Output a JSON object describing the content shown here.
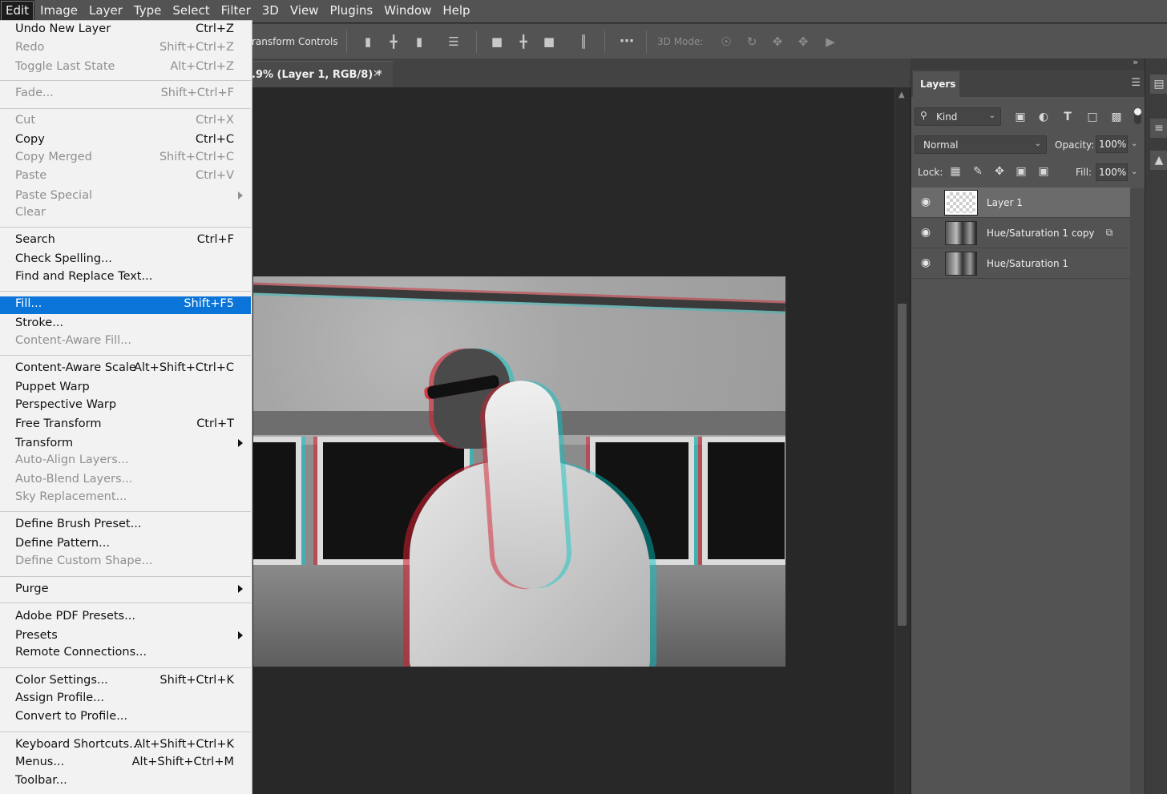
{
  "menubar": {
    "items": [
      "Edit",
      "Image",
      "Layer",
      "Type",
      "Select",
      "Filter",
      "3D",
      "View",
      "Plugins",
      "Window",
      "Help"
    ],
    "active_index": 0
  },
  "options_bar": {
    "transform_controls_text": "ransform Controls",
    "more_icon": "ellipsis-icon",
    "three_d_mode_label": "3D Mode:"
  },
  "document_tab": {
    "title": ".9% (Layer 1, RGB/8) *",
    "close_icon": "close-icon"
  },
  "edit_menu": {
    "items": [
      {
        "label": "Undo New Layer",
        "shortcut": "Ctrl+Z",
        "disabled": false
      },
      {
        "label": "Redo",
        "shortcut": "Shift+Ctrl+Z",
        "disabled": true
      },
      {
        "label": "Toggle Last State",
        "shortcut": "Alt+Ctrl+Z",
        "disabled": true
      },
      {
        "sep": true
      },
      {
        "label": "Fade...",
        "shortcut": "Shift+Ctrl+F",
        "disabled": true
      },
      {
        "sep": true
      },
      {
        "label": "Cut",
        "shortcut": "Ctrl+X",
        "disabled": true
      },
      {
        "label": "Copy",
        "shortcut": "Ctrl+C",
        "disabled": false
      },
      {
        "label": "Copy Merged",
        "shortcut": "Shift+Ctrl+C",
        "disabled": true
      },
      {
        "label": "Paste",
        "shortcut": "Ctrl+V",
        "disabled": true
      },
      {
        "label": "Paste Special",
        "shortcut": "",
        "disabled": true,
        "submenu": true
      },
      {
        "label": "Clear",
        "shortcut": "",
        "disabled": true
      },
      {
        "sep": true
      },
      {
        "label": "Search",
        "shortcut": "Ctrl+F",
        "disabled": false
      },
      {
        "label": "Check Spelling...",
        "shortcut": "",
        "disabled": false
      },
      {
        "label": "Find and Replace Text...",
        "shortcut": "",
        "disabled": false
      },
      {
        "sep": true
      },
      {
        "label": "Fill...",
        "shortcut": "Shift+F5",
        "disabled": false,
        "highlighted": true
      },
      {
        "label": "Stroke...",
        "shortcut": "",
        "disabled": false
      },
      {
        "label": "Content-Aware Fill...",
        "shortcut": "",
        "disabled": true
      },
      {
        "sep": true
      },
      {
        "label": "Content-Aware Scale",
        "shortcut": "Alt+Shift+Ctrl+C",
        "disabled": false
      },
      {
        "label": "Puppet Warp",
        "shortcut": "",
        "disabled": false
      },
      {
        "label": "Perspective Warp",
        "shortcut": "",
        "disabled": false
      },
      {
        "label": "Free Transform",
        "shortcut": "Ctrl+T",
        "disabled": false
      },
      {
        "label": "Transform",
        "shortcut": "",
        "disabled": false,
        "submenu": true
      },
      {
        "label": "Auto-Align Layers...",
        "shortcut": "",
        "disabled": true
      },
      {
        "label": "Auto-Blend Layers...",
        "shortcut": "",
        "disabled": true
      },
      {
        "label": "Sky Replacement...",
        "shortcut": "",
        "disabled": true
      },
      {
        "sep": true
      },
      {
        "label": "Define Brush Preset...",
        "shortcut": "",
        "disabled": false
      },
      {
        "label": "Define Pattern...",
        "shortcut": "",
        "disabled": false
      },
      {
        "label": "Define Custom Shape...",
        "shortcut": "",
        "disabled": true
      },
      {
        "sep": true
      },
      {
        "label": "Purge",
        "shortcut": "",
        "disabled": false,
        "submenu": true
      },
      {
        "sep": true
      },
      {
        "label": "Adobe PDF Presets...",
        "shortcut": "",
        "disabled": false
      },
      {
        "label": "Presets",
        "shortcut": "",
        "disabled": false,
        "submenu": true
      },
      {
        "label": "Remote Connections...",
        "shortcut": "",
        "disabled": false
      },
      {
        "sep": true
      },
      {
        "label": "Color Settings...",
        "shortcut": "Shift+Ctrl+K",
        "disabled": false
      },
      {
        "label": "Assign Profile...",
        "shortcut": "",
        "disabled": false
      },
      {
        "label": "Convert to Profile...",
        "shortcut": "",
        "disabled": false
      },
      {
        "sep": true
      },
      {
        "label": "Keyboard Shortcuts...",
        "shortcut": "Alt+Shift+Ctrl+K",
        "disabled": false
      },
      {
        "label": "Menus...",
        "shortcut": "Alt+Shift+Ctrl+M",
        "disabled": false
      },
      {
        "label": "Toolbar...",
        "shortcut": "",
        "disabled": false
      }
    ]
  },
  "layers_panel": {
    "tab_label": "Layers",
    "filter_kind_label": "Kind",
    "blend_mode": "Normal",
    "opacity_label": "Opacity:",
    "opacity_value": "100%",
    "lock_label": "Lock:",
    "fill_label": "Fill:",
    "fill_value": "100%",
    "layers": [
      {
        "name": "Layer 1",
        "selected": true,
        "thumb": "transparent",
        "badge": ""
      },
      {
        "name": "Hue/Saturation 1 copy",
        "selected": false,
        "thumb": "photo",
        "badge": "smart-object-icon"
      },
      {
        "name": "Hue/Saturation 1",
        "selected": false,
        "thumb": "photo",
        "badge": ""
      }
    ]
  },
  "colors": {
    "menu_highlight": "#0a74d9",
    "ui_dark": "#535353",
    "canvas_bg": "#282828"
  }
}
